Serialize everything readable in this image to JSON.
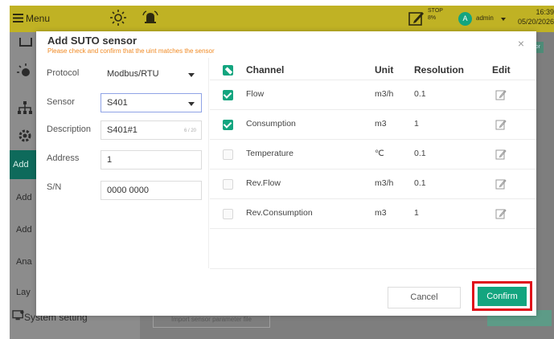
{
  "topbar": {
    "menu_label": "Menu",
    "stop_label": "STOP",
    "stop_value": "8%",
    "avatar_letter": "A",
    "user_name": "admin",
    "time": "16:39",
    "date": "05/20/2026"
  },
  "sidebar": {
    "items": [
      {
        "label": "Add",
        "active": true
      },
      {
        "label": "Add"
      },
      {
        "label": "Add"
      },
      {
        "label": "Ana"
      },
      {
        "label": "Lay"
      }
    ],
    "system_setting": "System setting"
  },
  "background": {
    "import_button": "Import sensor parameter file",
    "sensor_tab": "sor"
  },
  "dialog": {
    "title": "Add SUTO sensor",
    "subtitle": "Please check and confirm that the uint matches the sensor",
    "form": {
      "protocol_label": "Protocol",
      "protocol_value": "Modbus/RTU",
      "sensor_label": "Sensor",
      "sensor_value": "S401",
      "description_label": "Description",
      "description_value": "S401#1",
      "description_counter": "6 / 20",
      "address_label": "Address",
      "address_value": "1",
      "sn_label": "S/N",
      "sn_value": "0000 0000"
    },
    "table": {
      "headers": {
        "channel": "Channel",
        "unit": "Unit",
        "resolution": "Resolution",
        "edit": "Edit"
      },
      "rows": [
        {
          "channel": "Flow",
          "unit": "m3/h",
          "resolution": "0.1",
          "checked": true
        },
        {
          "channel": "Consumption",
          "unit": "m3",
          "resolution": "1",
          "checked": true
        },
        {
          "channel": "Temperature",
          "unit": "℃",
          "resolution": "0.1",
          "checked": false
        },
        {
          "channel": "Rev.Flow",
          "unit": "m3/h",
          "resolution": "0.1",
          "checked": false
        },
        {
          "channel": "Rev.Consumption",
          "unit": "m3",
          "resolution": "1",
          "checked": false
        }
      ]
    },
    "buttons": {
      "cancel": "Cancel",
      "confirm": "Confirm"
    }
  },
  "colors": {
    "topbar": "#c0b224",
    "accent": "#13a57f",
    "highlight": "#e0101a",
    "subtitle": "#f08a24"
  }
}
